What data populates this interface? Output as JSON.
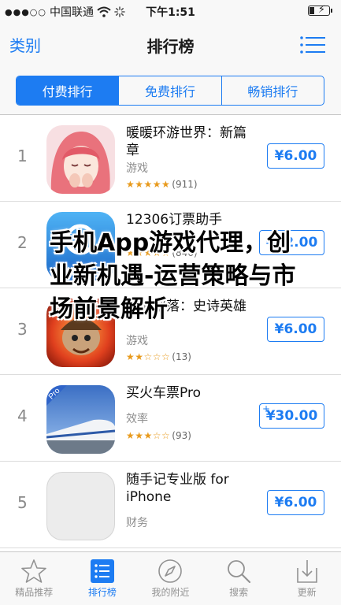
{
  "status_bar": {
    "carrier": "中国联通",
    "time": "下午1:51",
    "signal_dots": "●●●○○"
  },
  "nav": {
    "back_label": "类别",
    "title": "排行榜"
  },
  "segments": [
    {
      "label": "付费排行",
      "active": true
    },
    {
      "label": "免费排行",
      "active": false
    },
    {
      "label": "畅销排行",
      "active": false
    }
  ],
  "apps": [
    {
      "rank": "1",
      "name": "暖暖环游世界：新篇章",
      "category": "游戏",
      "stars": "★★★★★",
      "rating_count": "(911)",
      "price": "¥6.00",
      "has_plus": false
    },
    {
      "rank": "2",
      "name": "12306订票助手",
      "category": "",
      "stars": "★★★★☆",
      "rating_count": "(846)",
      "price": "¥12.00",
      "has_plus": false
    },
    {
      "rank": "3",
      "name": "我的部落：史诗英雄",
      "category": "游戏",
      "stars": "★★☆☆☆",
      "rating_count": "(13)",
      "price": "¥6.00",
      "has_plus": false
    },
    {
      "rank": "4",
      "name": "买火车票Pro",
      "category": "效率",
      "stars": "★★★☆☆",
      "rating_count": "(93)",
      "price": "¥30.00",
      "has_plus": true
    },
    {
      "rank": "5",
      "name": "随手记专业版 for iPhone",
      "category": "财务",
      "stars": "",
      "rating_count": "",
      "price": "¥6.00",
      "has_plus": false
    }
  ],
  "overlay_text": "手机App游戏代理，创业新机遇-运营策略与市场前景解析",
  "tabs": [
    {
      "label": "精品推荐",
      "icon": "star-icon",
      "active": false
    },
    {
      "label": "排行榜",
      "icon": "ranking-list-icon",
      "active": true
    },
    {
      "label": "我的附近",
      "icon": "compass-icon",
      "active": false
    },
    {
      "label": "搜索",
      "icon": "search-icon",
      "active": false
    },
    {
      "label": "更新",
      "icon": "update-tray-icon",
      "active": false
    }
  ],
  "colors": {
    "accent": "#1d7cf2",
    "star": "#e89a1c"
  }
}
